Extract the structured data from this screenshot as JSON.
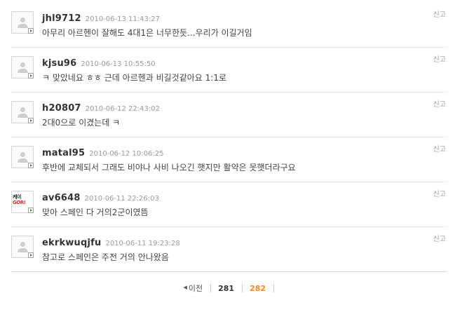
{
  "comments": [
    {
      "author": "jhl9712",
      "date": "2010-06-13 11:43:27",
      "text": "아무리 아르헨이 잘해도 4대1은 너무한듯...우리가 이길거임",
      "report": "신고"
    },
    {
      "author": "kjsu96",
      "date": "2010-06-13 10:55:50",
      "text": "ㅋ 맞았네요 ㅎㅎ 근데 아르헨과 비길것같아요 1:1로",
      "report": "신고"
    },
    {
      "author": "h20807",
      "date": "2010-06-12 22:43:02",
      "text": "2대0으로 이겼는데 ㅋ",
      "report": "신고"
    },
    {
      "author": "matal95",
      "date": "2010-06-12 10:06:25",
      "text": "후반에 교체되서 그래도 비야나 사비 나오긴 햇지만 활약은 못햇더라구요",
      "report": "신고"
    },
    {
      "author": "av6648",
      "date": "2010-06-11 22:26:03",
      "text": "맞아 스페인 다 거의2군이였뜸",
      "report": "신고",
      "avatar_text": [
        "케이",
        "GOR!"
      ]
    },
    {
      "author": "ekrkwuqjfu",
      "date": "2010-06-11 19:23:28",
      "text": "참고로 스페인은 주전 거의 안나왔음",
      "report": "신고"
    }
  ],
  "pagination": {
    "prev_label": "이전",
    "pages": [
      "281",
      "282"
    ],
    "current": "282"
  },
  "colors": {
    "current_page": "#f08a24",
    "divider": "#e6e6e6"
  }
}
